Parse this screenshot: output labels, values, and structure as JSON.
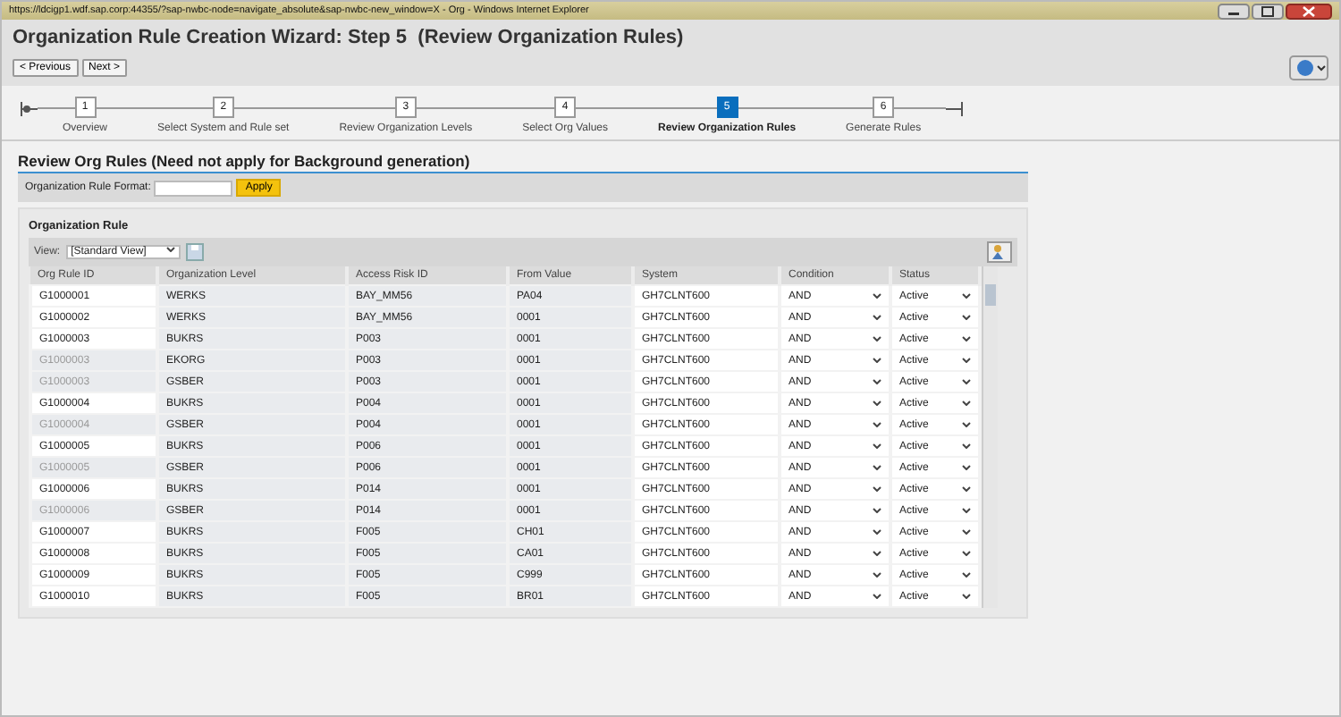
{
  "browser": {
    "title": "https://ldcigp1.wdf.sap.corp:44355/?sap-nwbc-node=navigate_absolute&sap-nwbc-new_window=X - Org - Windows Internet Explorer"
  },
  "page_title": "Organization Rule Creation Wizard: Step 5  (Review Organization Rules)",
  "nav_buttons": [
    {
      "label": "< Previous"
    },
    {
      "label": "Next >"
    }
  ],
  "steps": [
    {
      "number": "1",
      "label": "Overview",
      "selected": false
    },
    {
      "number": "2",
      "label": "Select System and Rule set",
      "selected": false
    },
    {
      "number": "3",
      "label": "Review Organization Levels",
      "selected": false
    },
    {
      "number": "4",
      "label": "Select Org Values",
      "selected": false
    },
    {
      "number": "5",
      "label": "Review Organization Rules",
      "selected": true
    },
    {
      "number": "6",
      "label": "Generate Rules",
      "selected": false
    }
  ],
  "section_title": "Review Org Rules (Need not apply for Background generation)",
  "format_field": {
    "label": "Organization Rule Format:"
  },
  "apply_button": "Apply",
  "group_title": "Organization Rule",
  "view": {
    "label": "View:",
    "value": "[Standard View]"
  },
  "table": {
    "columns": [
      "Org Rule ID",
      "Organization Level",
      "Access Risk ID",
      "From Value",
      "System",
      "Condition",
      "Status"
    ],
    "rows": [
      {
        "id": "G1000001",
        "dimmed": false,
        "level": "WERKS",
        "risk": "BAY_MM56",
        "from": "PA04",
        "system": "GH7CLNT600",
        "condition": "AND",
        "status": "Active"
      },
      {
        "id": "G1000002",
        "dimmed": false,
        "level": "WERKS",
        "risk": "BAY_MM56",
        "from": "0001",
        "system": "GH7CLNT600",
        "condition": "AND",
        "status": "Active"
      },
      {
        "id": "G1000003",
        "dimmed": false,
        "level": "BUKRS",
        "risk": "P003",
        "from": "0001",
        "system": "GH7CLNT600",
        "condition": "AND",
        "status": "Active"
      },
      {
        "id": "G1000003",
        "dimmed": true,
        "level": "EKORG",
        "risk": "P003",
        "from": "0001",
        "system": "GH7CLNT600",
        "condition": "AND",
        "status": "Active"
      },
      {
        "id": "G1000003",
        "dimmed": true,
        "level": "GSBER",
        "risk": "P003",
        "from": "0001",
        "system": "GH7CLNT600",
        "condition": "AND",
        "status": "Active"
      },
      {
        "id": "G1000004",
        "dimmed": false,
        "level": "BUKRS",
        "risk": "P004",
        "from": "0001",
        "system": "GH7CLNT600",
        "condition": "AND",
        "status": "Active"
      },
      {
        "id": "G1000004",
        "dimmed": true,
        "level": "GSBER",
        "risk": "P004",
        "from": "0001",
        "system": "GH7CLNT600",
        "condition": "AND",
        "status": "Active"
      },
      {
        "id": "G1000005",
        "dimmed": false,
        "level": "BUKRS",
        "risk": "P006",
        "from": "0001",
        "system": "GH7CLNT600",
        "condition": "AND",
        "status": "Active"
      },
      {
        "id": "G1000005",
        "dimmed": true,
        "level": "GSBER",
        "risk": "P006",
        "from": "0001",
        "system": "GH7CLNT600",
        "condition": "AND",
        "status": "Active"
      },
      {
        "id": "G1000006",
        "dimmed": false,
        "level": "BUKRS",
        "risk": "P014",
        "from": "0001",
        "system": "GH7CLNT600",
        "condition": "AND",
        "status": "Active"
      },
      {
        "id": "G1000006",
        "dimmed": true,
        "level": "GSBER",
        "risk": "P014",
        "from": "0001",
        "system": "GH7CLNT600",
        "condition": "AND",
        "status": "Active"
      },
      {
        "id": "G1000007",
        "dimmed": false,
        "level": "BUKRS",
        "risk": "F005",
        "from": "CH01",
        "system": "GH7CLNT600",
        "condition": "AND",
        "status": "Active"
      },
      {
        "id": "G1000008",
        "dimmed": false,
        "level": "BUKRS",
        "risk": "F005",
        "from": "CA01",
        "system": "GH7CLNT600",
        "condition": "AND",
        "status": "Active"
      },
      {
        "id": "G1000009",
        "dimmed": false,
        "level": "BUKRS",
        "risk": "F005",
        "from": "C999",
        "system": "GH7CLNT600",
        "condition": "AND",
        "status": "Active"
      },
      {
        "id": "G1000010",
        "dimmed": false,
        "level": "BUKRS",
        "risk": "F005",
        "from": "BR01",
        "system": "GH7CLNT600",
        "condition": "AND",
        "status": "Active"
      }
    ]
  }
}
